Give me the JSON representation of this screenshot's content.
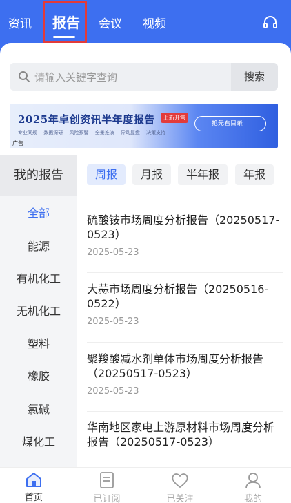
{
  "topnav": {
    "tabs": [
      {
        "label": "资讯"
      },
      {
        "label": "报告"
      },
      {
        "label": "会议"
      },
      {
        "label": "视频"
      }
    ],
    "active_tab": "报告",
    "headset_icon": "headset-icon"
  },
  "search": {
    "placeholder": "请输入关键字查询",
    "button_label": "搜索"
  },
  "banner": {
    "title": "2025年卓创资讯半年度报告",
    "tag": "上新开售",
    "subs": [
      "专业同规",
      "数据深研",
      "风险预警",
      "全景推演",
      "异动复盘",
      "决策支持"
    ],
    "cta": "抢先看目录",
    "ad_label": "广告"
  },
  "sidebar": {
    "header": "我的报告",
    "items": [
      "全部",
      "能源",
      "有机化工",
      "无机化工",
      "塑料",
      "橡胶",
      "氯碱",
      "煤化工"
    ],
    "active": "全部"
  },
  "periods": {
    "items": [
      "周报",
      "月报",
      "半年报",
      "年报"
    ],
    "active": "周报"
  },
  "reports": [
    {
      "title": "硫酸铵市场周度分析报告（20250517-0523）",
      "date": "2025-05-23"
    },
    {
      "title": "大蒜市场周度分析报告（20250516-0522）",
      "date": "2025-05-23"
    },
    {
      "title": "聚羧酸减水剂单体市场周度分析报告（20250517-0523）",
      "date": "2025-05-23"
    },
    {
      "title": "华南地区家电上游原材料市场周度分析报告（20250517-0523）",
      "date": ""
    }
  ],
  "tabbar": {
    "items": [
      {
        "label": "首页",
        "icon": "home-icon"
      },
      {
        "label": "已订阅",
        "icon": "subscribed-icon"
      },
      {
        "label": "已关注",
        "icon": "heart-icon"
      },
      {
        "label": "我的",
        "icon": "user-icon"
      }
    ],
    "active": "首页"
  },
  "colors": {
    "brand": "#3d6ff0",
    "highlight_box": "#e23a3a"
  }
}
